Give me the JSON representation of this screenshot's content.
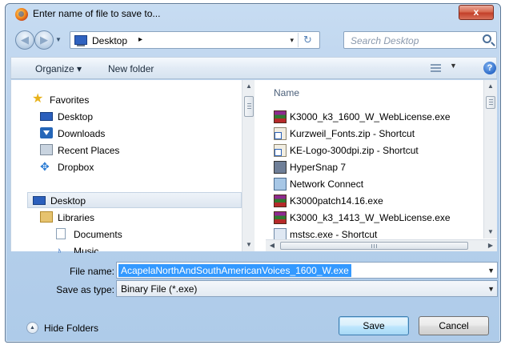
{
  "window": {
    "title": "Enter name of file to save to...",
    "close_label": "x"
  },
  "nav": {
    "back_glyph": "◀",
    "forward_glyph": "▶"
  },
  "address": {
    "location": "Desktop",
    "chevron": "▸",
    "dropdown": "▾",
    "refresh_glyph": "↻"
  },
  "search": {
    "placeholder": "Search Desktop"
  },
  "toolbar": {
    "organize_label": "Organize ▾",
    "new_folder_label": "New folder",
    "help_label": "?"
  },
  "sidebar": {
    "items": [
      {
        "label": "Favorites",
        "icon": "favorites-star-icon"
      },
      {
        "label": "Desktop",
        "icon": "desktop-icon"
      },
      {
        "label": "Downloads",
        "icon": "downloads-icon"
      },
      {
        "label": "Recent Places",
        "icon": "recent-places-icon"
      },
      {
        "label": "Dropbox",
        "icon": "dropbox-icon"
      },
      {
        "label": "Desktop",
        "icon": "desktop-icon",
        "selected": true
      },
      {
        "label": "Libraries",
        "icon": "libraries-icon"
      },
      {
        "label": "Documents",
        "icon": "documents-icon"
      },
      {
        "label": "Music",
        "icon": "music-icon"
      }
    ]
  },
  "filelist": {
    "column_name": "Name",
    "files": [
      {
        "name": "K3000_k3_1600_W_WebLicense.exe",
        "icon": "winrar-icon"
      },
      {
        "name": "Kurzweil_Fonts.zip - Shortcut",
        "icon": "zip-shortcut-icon"
      },
      {
        "name": "KE-Logo-300dpi.zip - Shortcut",
        "icon": "zip-shortcut-icon"
      },
      {
        "name": "HyperSnap 7",
        "icon": "hypersnap-icon"
      },
      {
        "name": "Network Connect",
        "icon": "network-connect-icon"
      },
      {
        "name": "K3000patch14.16.exe",
        "icon": "winrar-icon"
      },
      {
        "name": "K3000_k3_1413_W_WebLicense.exe",
        "icon": "winrar-icon"
      },
      {
        "name": "mstsc.exe - Shortcut",
        "icon": "remote-desktop-icon"
      }
    ]
  },
  "form": {
    "file_name_label": "File name:",
    "file_name_value": "AcapelaNorthAndSouthAmericanVoices_1600_W.exe",
    "save_as_type_label": "Save as type:",
    "save_as_type_value": "Binary File (*.exe)"
  },
  "footer": {
    "hide_folders_label": "Hide Folders",
    "save_label": "Save",
    "cancel_label": "Cancel"
  },
  "colors": {
    "selection": "#3399ff",
    "window_frame": "#b9d1ec",
    "close_button": "#c3402a"
  }
}
